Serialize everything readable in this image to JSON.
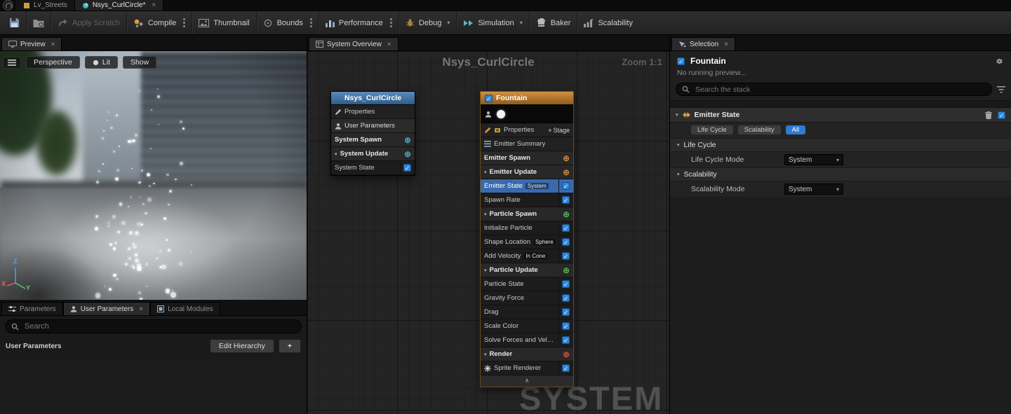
{
  "colors": {
    "accent_blue": "#3286d8",
    "selected_row": "#3a6aad",
    "fountain_header": "#b5772e",
    "system_header": "#3f74a8",
    "plus_system": "#5fb3d9",
    "plus_emitter": "#e0913c",
    "plus_particle": "#57c056",
    "plus_render": "#e05a43",
    "all_tab_bg": "#2e7bd0"
  },
  "titlebar": {
    "tabs": [
      {
        "label": "Lv_Streets",
        "icon": "level",
        "active": false,
        "closable": false
      },
      {
        "label": "Nsys_CurlCircle*",
        "icon": "niagara",
        "active": true,
        "closable": true
      }
    ],
    "close_glyph": "×"
  },
  "toolbar": {
    "items": [
      {
        "icon": "save",
        "name": "save-button"
      },
      {
        "icon": "browse",
        "name": "browse-button"
      },
      {
        "label": "Apply Scratch",
        "icon": "apply-scratch",
        "name": "apply-scratch-button",
        "disabled": true
      },
      {
        "label": "Compile",
        "icon": "compile",
        "name": "compile-button",
        "kebab": true
      },
      {
        "label": "Thumbnail",
        "icon": "thumbnail",
        "name": "thumbnail-button"
      },
      {
        "label": "Bounds",
        "icon": "bounds",
        "name": "bounds-button",
        "kebab": true
      },
      {
        "label": "Performance",
        "icon": "performance",
        "name": "performance-button",
        "kebab": true
      },
      {
        "label": "Debug",
        "icon": "debug",
        "name": "debug-button",
        "caret": true
      },
      {
        "label": "Simulation",
        "icon": "simulation",
        "name": "simulation-button",
        "caret": true
      },
      {
        "label": "Baker",
        "icon": "baker",
        "name": "baker-button"
      },
      {
        "label": "Scalability",
        "icon": "scalability",
        "name": "scalability-button"
      }
    ]
  },
  "preview": {
    "tab_label": "Preview",
    "buttons": {
      "perspective": "Perspective",
      "lit": "Lit",
      "show": "Show"
    },
    "axis_labels": {
      "x": "X",
      "y": "Y",
      "z": "Z"
    }
  },
  "parameters": {
    "tabs": [
      {
        "label": "Parameters",
        "icon": "params",
        "active": false,
        "closable": false
      },
      {
        "label": "User Parameters",
        "icon": "person",
        "active": true,
        "closable": true
      },
      {
        "label": "Local Modules",
        "icon": "modules",
        "active": false,
        "closable": false
      }
    ],
    "search_placeholder": "Search",
    "section_label": "User Parameters",
    "edit_hierarchy": "Edit Hierarchy",
    "add_button": "+"
  },
  "graph": {
    "tab_label": "System Overview",
    "title": "Nsys_CurlCircle",
    "zoom_label": "Zoom 1:1",
    "watermark": "SYSTEM",
    "system_node": {
      "title": "Nsys_CurlCircle",
      "rows": [
        {
          "type": "item",
          "label": "Properties",
          "icon": "pencil"
        },
        {
          "type": "category",
          "label": "User Parameters",
          "icon": "person"
        },
        {
          "type": "group",
          "label": "System Spawn",
          "plus": "plus_system"
        },
        {
          "type": "group",
          "label": "System Update",
          "plus": "plus_system",
          "collapsible": true
        },
        {
          "type": "module",
          "label": "System State",
          "checked": true
        }
      ]
    },
    "emitter_node": {
      "title": "Fountain",
      "checked": true,
      "rows": [
        {
          "type": "item",
          "label": "Properties",
          "icon": "brush",
          "icon2": "chip",
          "right_label": "+ Stage"
        },
        {
          "type": "item",
          "label": "Emitter Summary",
          "icon": "summary"
        },
        {
          "type": "group",
          "label": "Emitter Spawn",
          "plus": "plus_emitter"
        },
        {
          "type": "group",
          "label": "Emitter Update",
          "plus": "plus_emitter",
          "collapsible": true
        },
        {
          "type": "module",
          "label": "Emitter State",
          "badge": "System",
          "checked": true,
          "selected": true
        },
        {
          "type": "module",
          "label": "Spawn Rate",
          "checked": true
        },
        {
          "type": "group",
          "label": "Particle Spawn",
          "plus": "plus_particle",
          "collapsible": true
        },
        {
          "type": "module",
          "label": "Initialize Particle",
          "checked": true
        },
        {
          "type": "module",
          "label": "Shape Location",
          "badge": "Sphere",
          "checked": true
        },
        {
          "type": "module",
          "label": "Add Velocity",
          "badge": "In Cone",
          "checked": true
        },
        {
          "type": "group",
          "label": "Particle Update",
          "plus": "plus_particle",
          "collapsible": true
        },
        {
          "type": "module",
          "label": "Particle State",
          "checked": true
        },
        {
          "type": "module",
          "label": "Gravity Force",
          "checked": true
        },
        {
          "type": "module",
          "label": "Drag",
          "checked": true
        },
        {
          "type": "module",
          "label": "Scale Color",
          "checked": true
        },
        {
          "type": "module",
          "label": "Solve Forces and Velocity",
          "checked": true
        },
        {
          "type": "group",
          "label": "Render",
          "plus": "plus_render",
          "collapsible": true
        },
        {
          "type": "module",
          "label": "Sprite Renderer",
          "icon": "sprite",
          "checked": true
        }
      ],
      "footer_glyph": "∧"
    }
  },
  "selection": {
    "tab_label": "Selection",
    "header": {
      "title": "Fountain",
      "checked": true
    },
    "subtitle": "No running preview...",
    "search_placeholder": "Search the stack",
    "stack_header": {
      "label": "Emitter State",
      "checked": true
    },
    "filter_tabs": [
      {
        "label": "Life Cycle",
        "active": false
      },
      {
        "label": "Scalability",
        "active": false
      },
      {
        "label": "All",
        "active": true
      }
    ],
    "groups": [
      {
        "label": "Life Cycle",
        "rows": [
          {
            "label": "Life Cycle Mode",
            "value": "System"
          }
        ]
      },
      {
        "label": "Scalability",
        "rows": [
          {
            "label": "Scalability Mode",
            "value": "System"
          }
        ]
      }
    ]
  }
}
